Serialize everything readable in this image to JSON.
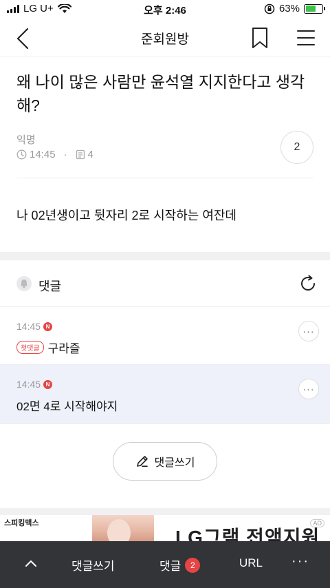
{
  "status": {
    "carrier": "LG U+",
    "time": "오후 2:46",
    "battery": "63%",
    "battery_level": 0.63,
    "battery_color": "#3fc24a"
  },
  "nav": {
    "title": "준회원방"
  },
  "post": {
    "title": "왜 나이 많은 사람만 윤석열 지지한다고 생각해?",
    "author": "익명",
    "time": "14:45",
    "views": "4",
    "comment_count": "2",
    "body": "나 02년생이고 뒷자리 2로 시작하는 여잔데"
  },
  "comments": {
    "header": "댓글",
    "items": [
      {
        "time": "14:45",
        "new_badge": "N",
        "first_badge": "첫댓글",
        "text": "구라즐"
      },
      {
        "time": "14:45",
        "new_badge": "N",
        "text": "02면 4로 시작해야지"
      }
    ],
    "highlight_color": "#eef1fa",
    "write_button": "댓글쓰기"
  },
  "ad": {
    "brand": "스피킹맥스",
    "headline": "LG그램 전액지원",
    "tag": "AD"
  },
  "bottom_bar": {
    "write": "댓글쓰기",
    "comments": "댓글",
    "comment_badge": "2",
    "url": "URL",
    "more": "···"
  },
  "colors": {
    "accent_red": "#e64545",
    "bottom_bar": "#333438",
    "section_gray": "#f1f1f3"
  }
}
